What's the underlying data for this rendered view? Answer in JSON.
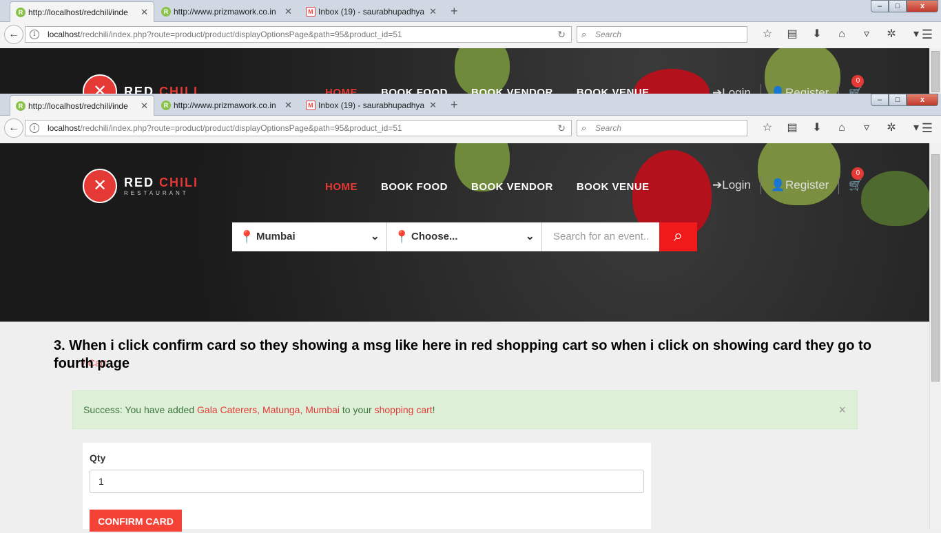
{
  "browser": {
    "tabs": [
      {
        "title": "http://localhost/redchili/inde",
        "favicon": "R"
      },
      {
        "title": "http://www.prizmawork.co.in",
        "favicon": "R"
      },
      {
        "title": "Inbox (19) - saurabhupadhya",
        "favicon": "M"
      }
    ],
    "new_tab": "+",
    "url_host": "localhost",
    "url_path": "/redchili/index.php?route=product/product/displayOptionsPage&path=95&product_id=51",
    "search_placeholder": "Search",
    "window_buttons": {
      "minimize": "–",
      "maximize": "□",
      "close": "x"
    }
  },
  "site": {
    "logo_word1": "RED",
    "logo_word2": "CHILI",
    "logo_sub": "RESTAURANT",
    "menu": [
      "HOME",
      "BOOK FOOD",
      "BOOK VENDOR",
      "BOOK VENUE"
    ],
    "login": "Login",
    "register": "Register",
    "cart_count": "0",
    "search": {
      "city": "Mumbai",
      "category": "Choose...",
      "event_placeholder": "Search for an event.."
    }
  },
  "annotation": "3. When i click confirm card so they showing a msg like here in red shopping cart so when i click on showing card they go to fourth page",
  "breadcrumb_fragment": "/ Cart",
  "alert": {
    "prefix": "Success: You have added ",
    "product": "Gala Caterers, Matunga, Mumbai",
    "middle": " to your ",
    "cart_link": "shopping cart",
    "suffix": "!",
    "close": "×"
  },
  "form": {
    "qty_label": "Qty",
    "qty_value": "1",
    "confirm": "CONFIRM CARD"
  },
  "colors": {
    "accent": "#e53935",
    "success_bg": "#dff0d8",
    "success_text": "#3c763d"
  }
}
